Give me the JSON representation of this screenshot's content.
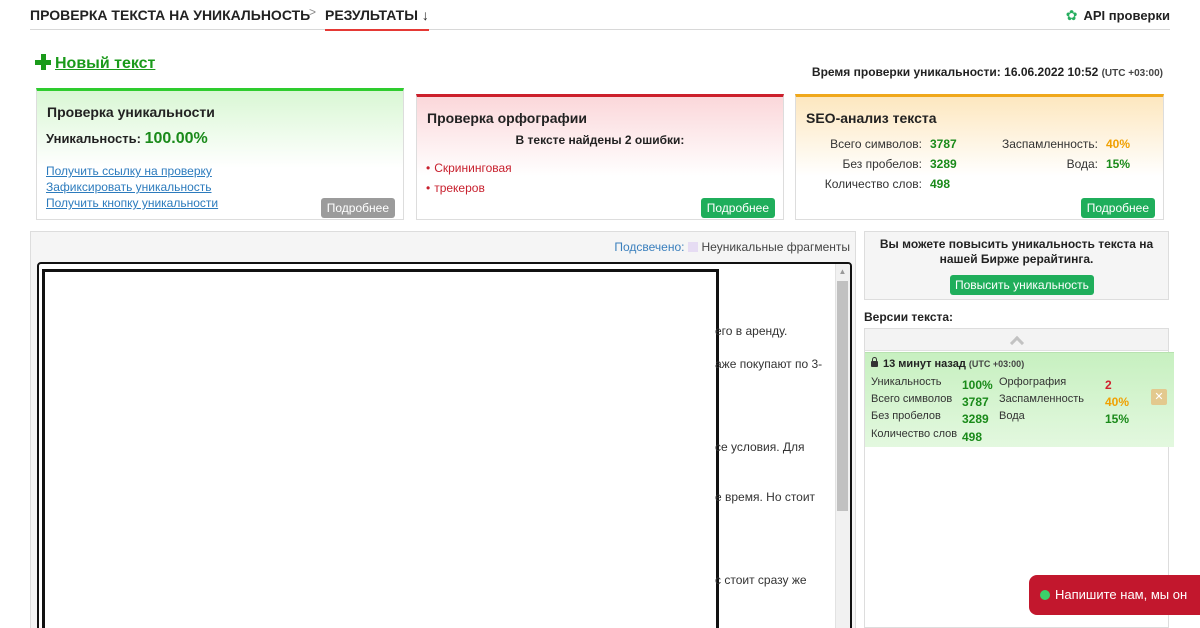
{
  "nav": {
    "crumb_check": "ПРОВЕРКА ТЕКСТА НА УНИКАЛЬНОСТЬ",
    "crumb_results": "РЕЗУЛЬТАТЫ",
    "crumb_results_arrow": "↓",
    "api_label": "API проверки",
    "api_icon": "gear-icon"
  },
  "toolbar": {
    "new_text": "Новый текст",
    "check_time_label": "Время проверки уникальности:",
    "check_time_value": "16.06.2022 10:52",
    "check_time_tz": "(UTC +03:00)"
  },
  "uniqueness_card": {
    "title": "Проверка уникальности",
    "uniq_label": "Уникальность:",
    "uniq_value": "100.00%",
    "links": [
      "Получить ссылку на проверку",
      "Зафиксировать уникальность",
      "Получить кнопку уникальности"
    ],
    "more": "Подробнее"
  },
  "spelling_card": {
    "title": "Проверка орфографии",
    "summary": "В тексте найдены 2 ошибки:",
    "errors": [
      "Скрининговая",
      "трекеров"
    ],
    "more": "Подробнее"
  },
  "seo_card": {
    "title": "SEO-анализ текста",
    "total_chars_label": "Всего символов:",
    "total_chars": "3787",
    "no_spaces_label": "Без пробелов:",
    "no_spaces": "3289",
    "words_label": "Количество слов:",
    "words": "498",
    "spam_label": "Заспамленность:",
    "spam": "40%",
    "water_label": "Вода:",
    "water": "15%",
    "more": "Подробнее"
  },
  "text_panel": {
    "highlight_label": "Подсвечено:",
    "highlight_desc": "Неуникальные фрагменты",
    "visible_fragments": [
      "его в аренду.",
      "аже покупают по 3-",
      "се условия. Для",
      "е время. Но стоит",
      "с стоит сразу же"
    ]
  },
  "promo": {
    "text": "Вы можете повысить уникальность текста на нашей Бирже рерайтинга.",
    "button": "Повысить уникальность"
  },
  "versions": {
    "title": "Версии текста:",
    "item": {
      "time": "13 минут назад",
      "tz": "(UTC +03:00)",
      "uniq_label": "Уникальность",
      "uniq": "100%",
      "spell_label": "Орфография",
      "spell": "2",
      "total_label": "Всего символов",
      "total": "3787",
      "spam_label": "Заспамленность",
      "spam": "40%",
      "nospace_label": "Без пробелов",
      "nospace": "3289",
      "water_label": "Вода",
      "water": "15%",
      "words_label": "Количество слов",
      "words": "498"
    }
  },
  "chat": {
    "label": "Напишите нам, мы он"
  },
  "colors": {
    "green": "#1a8a1a",
    "accent_red": "#e53935",
    "button_green": "#1fae5b",
    "orange": "#f0a000"
  }
}
